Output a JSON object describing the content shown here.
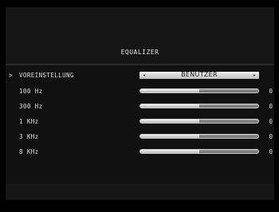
{
  "title": "EQUALIZER",
  "preset": {
    "label": "VOREINSTELLUNG",
    "value": "BENUTZER",
    "left_arrow": "◂",
    "right_arrow": "▸",
    "cursor": ">"
  },
  "bands": [
    {
      "label": "100 Hz",
      "value": "0",
      "level": 0.5
    },
    {
      "label": "300 Hz",
      "value": "0",
      "level": 0.5
    },
    {
      "label": "1 KHz",
      "value": "0",
      "level": 0.5
    },
    {
      "label": "3 KHz",
      "value": "0",
      "level": 0.5
    },
    {
      "label": "8 KHz",
      "value": "0",
      "level": 0.5
    }
  ],
  "colors": {
    "background": "#000000",
    "panel": "#111111",
    "text": "#e0e0e0",
    "slider_fill": "#f2f2f2",
    "slider_track": "#7a7a7a"
  }
}
